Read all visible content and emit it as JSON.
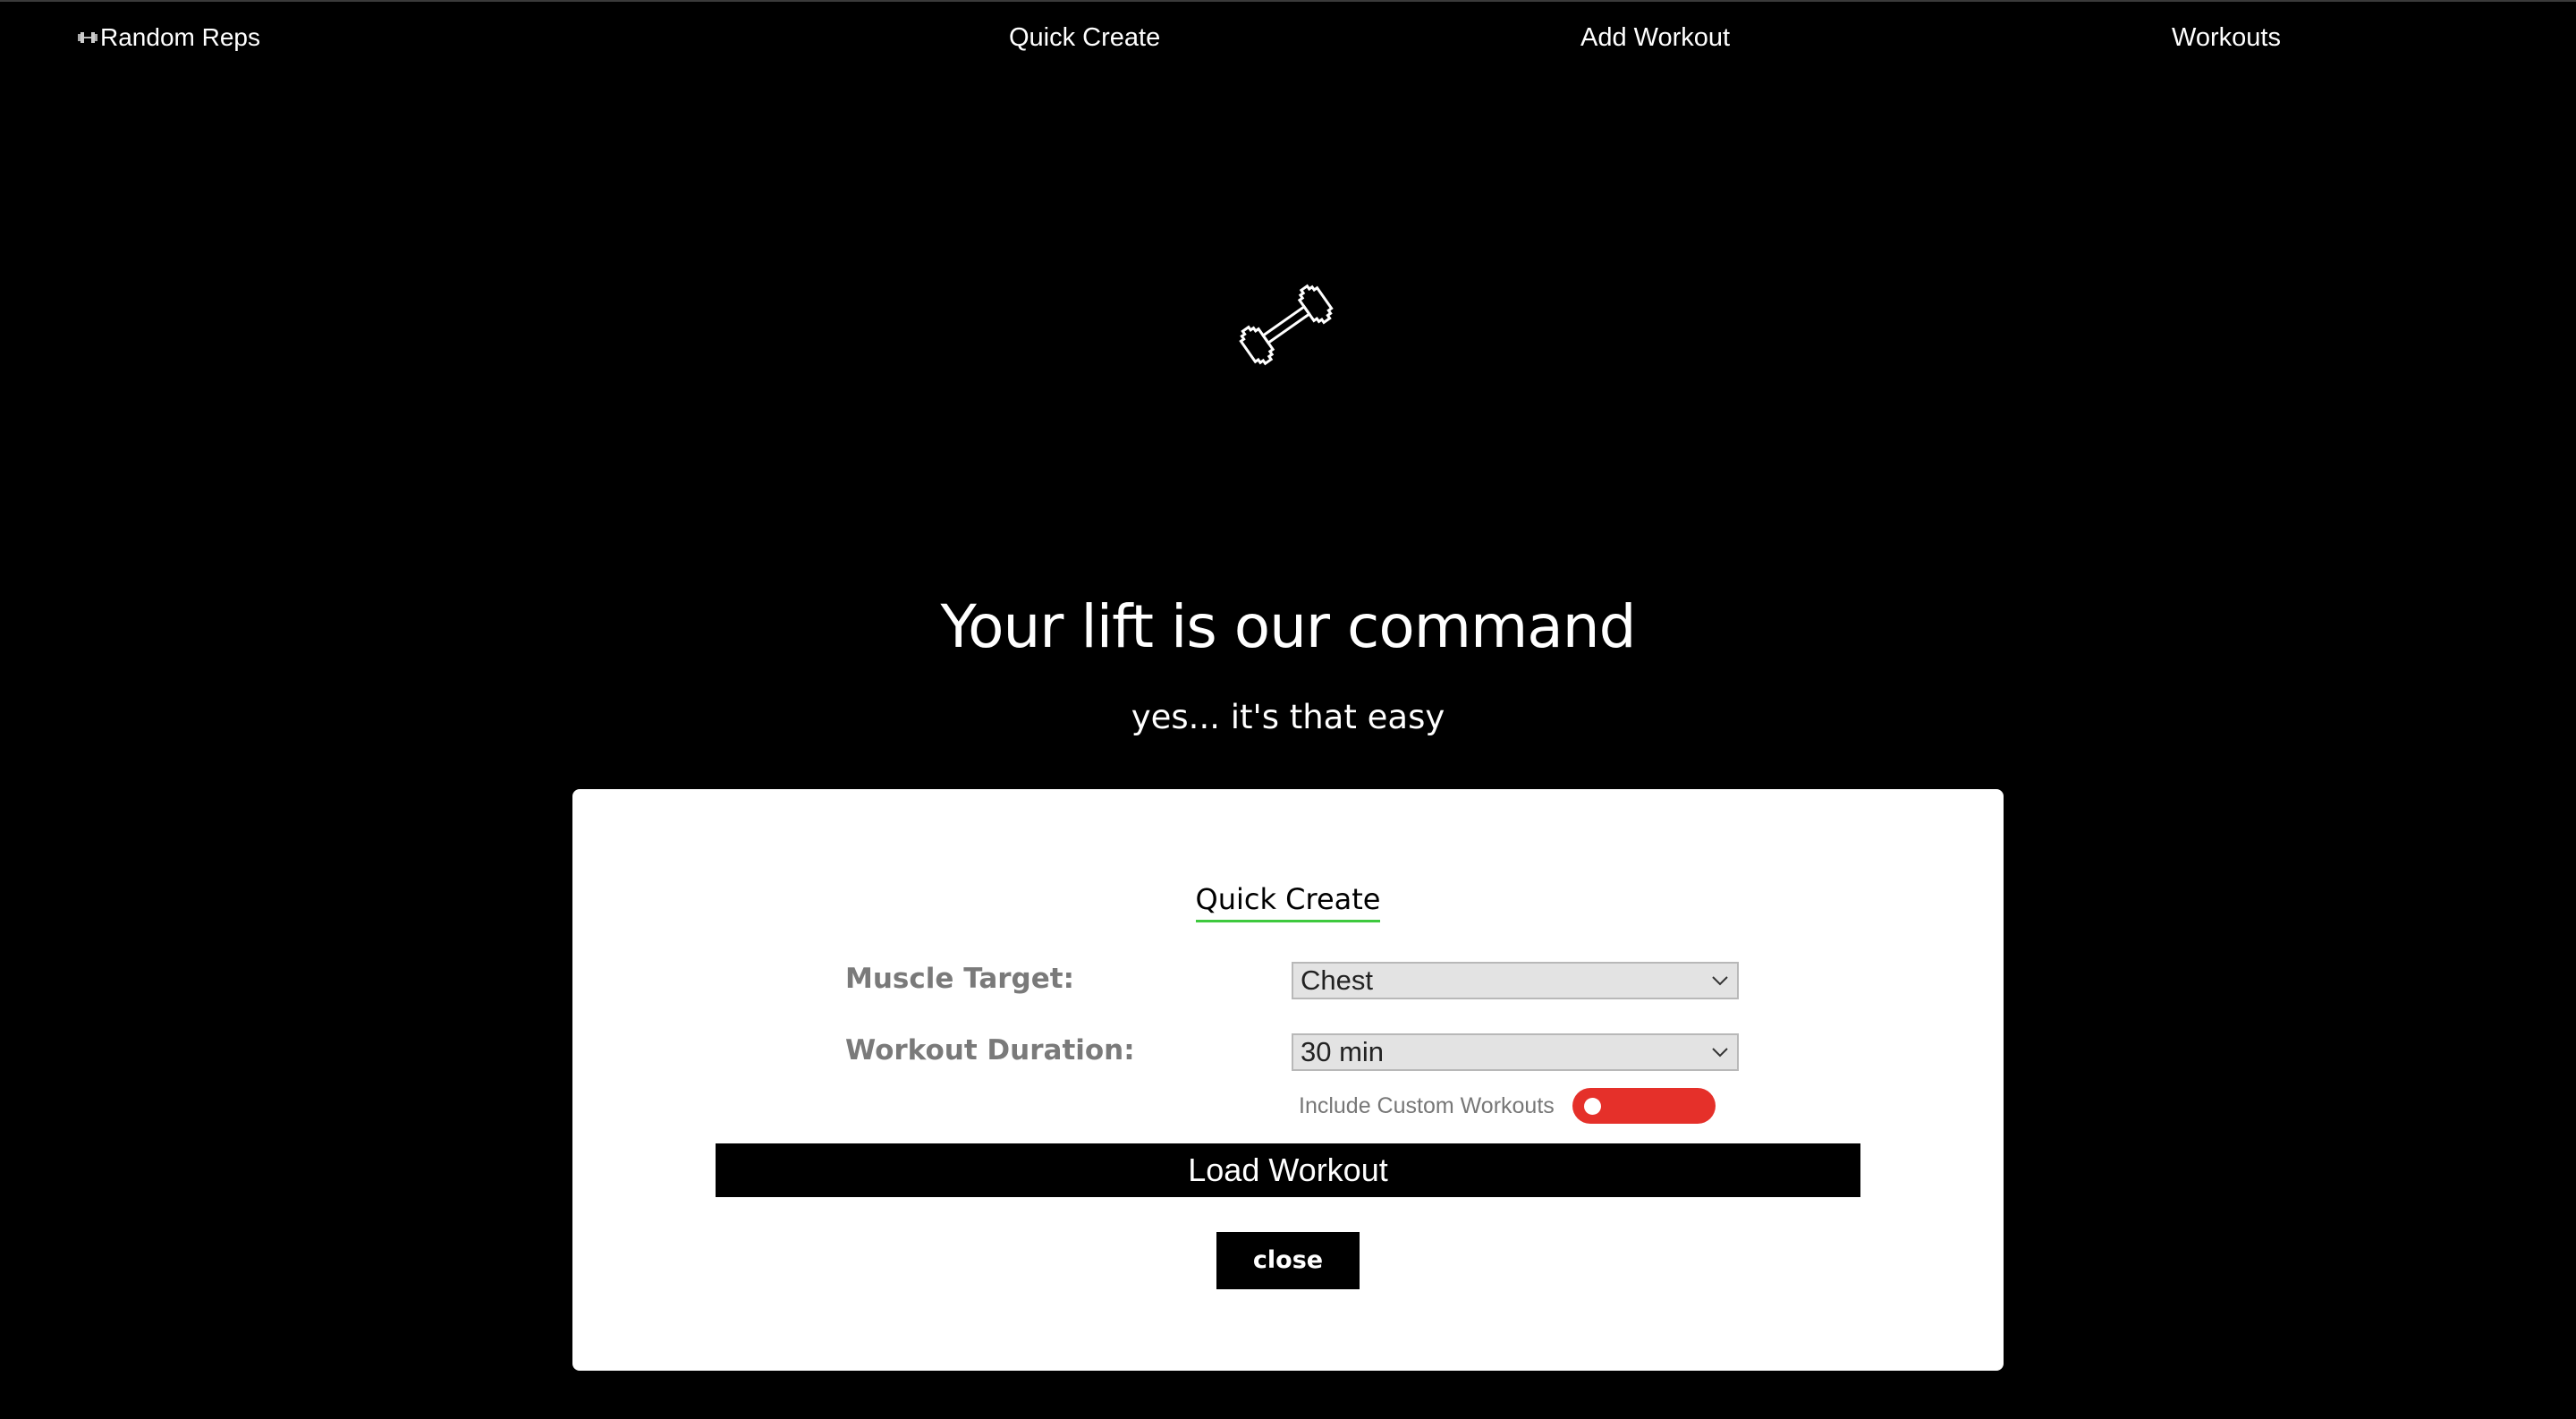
{
  "nav": {
    "brand_label": "Random Reps",
    "brand_icon": "dumbbell-icon",
    "links": [
      {
        "label": "Quick Create"
      },
      {
        "label": "Add Workout"
      },
      {
        "label": "Workouts"
      }
    ]
  },
  "hero": {
    "icon": "dumbbell-icon",
    "title": "Your lift is our command",
    "subtitle": "yes... it's that easy"
  },
  "modal": {
    "title": "Quick Create",
    "muscle_label": "Muscle Target:",
    "muscle_value": "Chest",
    "duration_label": "Workout Duration:",
    "duration_value": "30 min",
    "toggle_label": "Include Custom Workouts",
    "toggle_on": false,
    "load_label": "Load Workout",
    "close_label": "close"
  },
  "colors": {
    "background": "#000000",
    "accent_underline": "#3ec93e",
    "toggle_off": "#e5302a",
    "modal_bg": "#ffffff"
  }
}
